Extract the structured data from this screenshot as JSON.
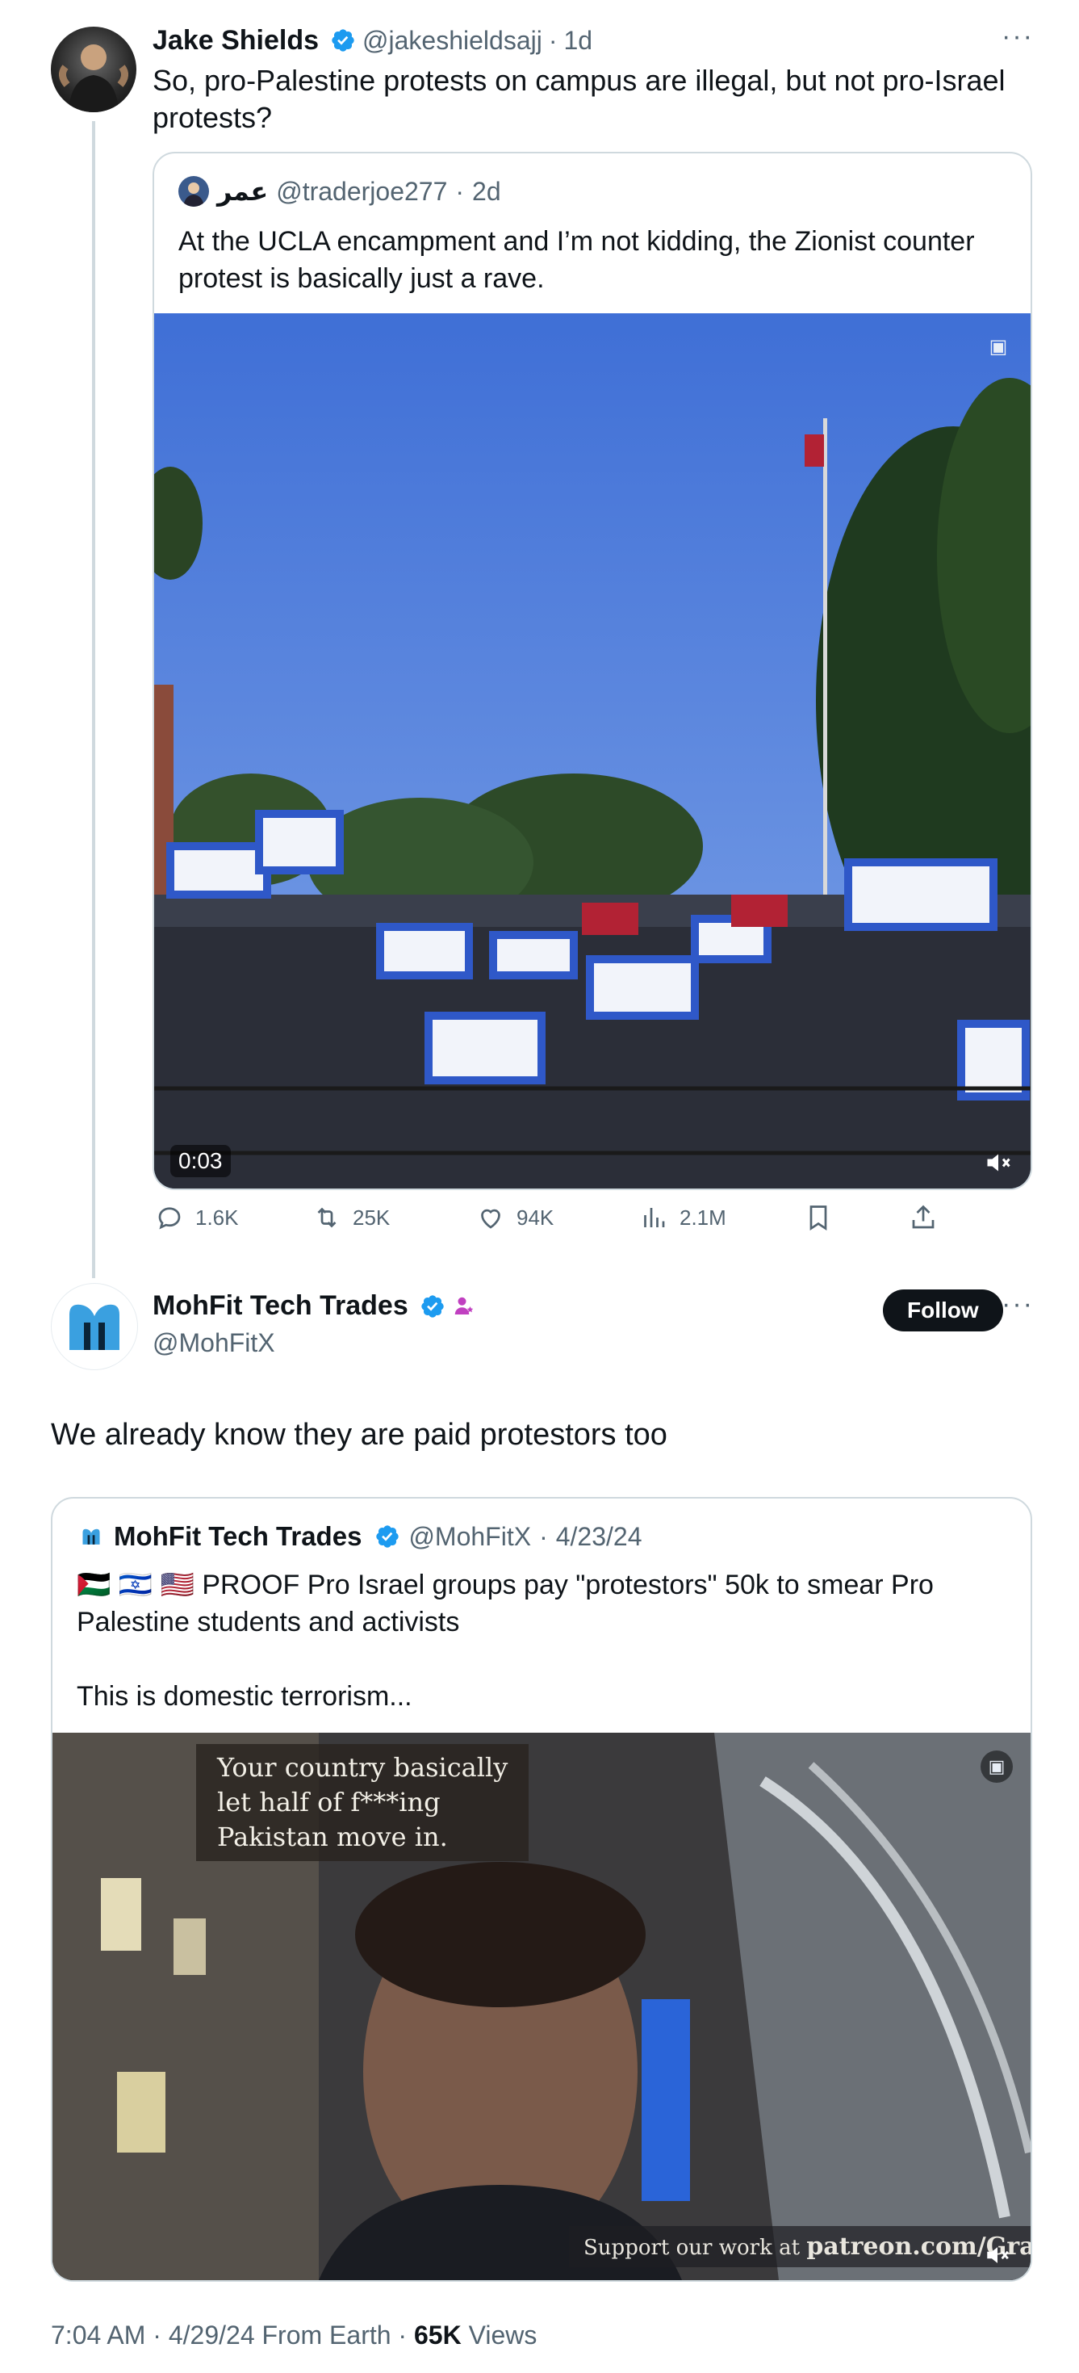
{
  "tweet1": {
    "name": "Jake Shields",
    "handle": "@jakeshieldsajj",
    "sep": "·",
    "time": "1d",
    "text": "So, pro-Palestine protests on campus are illegal, but not pro-Israel protests?",
    "quote": {
      "name": "عمر",
      "handle": "@traderjoe277",
      "sep": "·",
      "time": "2d",
      "text": "At the UCLA encampment and I’m not kidding, the Zionist counter protest is basically just a rave.",
      "video_time": "0:03"
    },
    "stats": {
      "replies": "1.6K",
      "reposts": "25K",
      "likes": "94K",
      "views": "2.1M"
    }
  },
  "tweet2": {
    "name": "MohFit Tech Trades",
    "handle": "@MohFitX",
    "follow_label": "Follow",
    "text": "We already know they are paid protestors too",
    "quote": {
      "name": "MohFit Tech Trades",
      "handle": "@MohFitX",
      "sep": "·",
      "time": "4/23/24",
      "flags": "🇵🇸 🇮🇱 🇺🇸",
      "text": "PROOF Pro Israel groups pay \"protestors\" 50k to smear Pro Palestine students and activists",
      "text2": "This is domestic terrorism...",
      "video_caption_line1": "Your country basically",
      "video_caption_line2": "let half of f***ing",
      "video_caption_line3": "Pakistan move in.",
      "watermark_prefix": "Support our work at ",
      "watermark_url": "patreon.com/Grayzone"
    },
    "footer": {
      "time": "7:04 AM",
      "date": "4/29/24",
      "from": "From Earth",
      "views_count": "65K",
      "views_label": "Views",
      "sep": "·"
    }
  },
  "colors": {
    "verified": "#1d9bf0",
    "text": "#0f1419",
    "secondary": "#536471",
    "border": "#cfd9de"
  }
}
